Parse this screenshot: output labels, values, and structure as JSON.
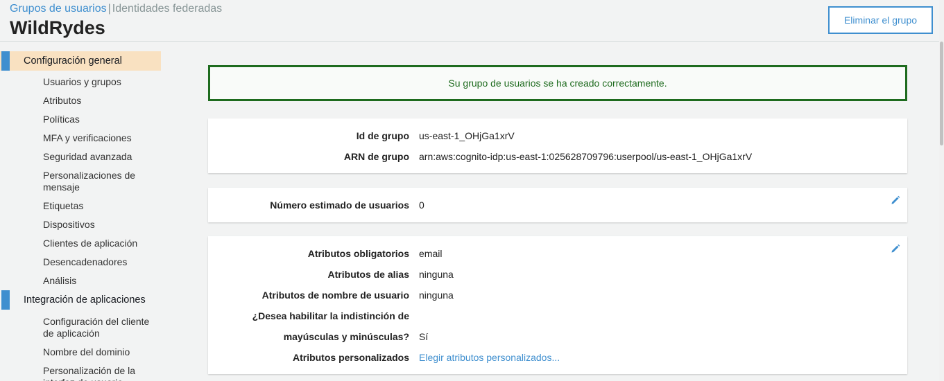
{
  "header": {
    "breadcrumb_link": "Grupos de usuarios",
    "breadcrumb_sep": "|",
    "breadcrumb_other": "Identidades federadas",
    "title": "WildRydes",
    "delete_label": "Eliminar el grupo"
  },
  "sidebar": {
    "general": {
      "label": "Configuración general",
      "items": [
        "Usuarios y grupos",
        "Atributos",
        "Políticas",
        "MFA y verificaciones",
        "Seguridad avanzada",
        "Personalizaciones de mensaje",
        "Etiquetas",
        "Dispositivos",
        "Clientes de aplicación",
        "Desencadenadores",
        "Análisis"
      ]
    },
    "integration": {
      "label": "Integración de aplicaciones",
      "items": [
        "Configuración del cliente de aplicación",
        "Nombre del dominio",
        "Personalización de la interfaz de usuario"
      ]
    }
  },
  "alert": {
    "message": "Su grupo de usuarios se ha creado correctamente."
  },
  "pool_info": {
    "id_label": "Id de grupo",
    "id_value": "us-east-1_OHjGa1xrV",
    "arn_label": "ARN de grupo",
    "arn_value": "arn:aws:cognito-idp:us-east-1:025628709796:userpool/us-east-1_OHjGa1xrV"
  },
  "users": {
    "count_label": "Número estimado de usuarios",
    "count_value": "0"
  },
  "attributes": {
    "required_label": "Atributos obligatorios",
    "required_value": "email",
    "alias_label": "Atributos de alias",
    "alias_value": "ninguna",
    "username_label": "Atributos de nombre de usuario",
    "username_value": "ninguna",
    "case_label_1": "¿Desea habilitar la indistinción de",
    "case_label_2": "mayúsculas y minúsculas?",
    "case_value": "Sí",
    "custom_label": "Atributos personalizados",
    "custom_link": "Elegir atributos personalizados..."
  },
  "colors": {
    "accent": "#3f8fcf",
    "success": "#1e6b1e",
    "active_nav": "#f9e1c1"
  },
  "icons": [
    "pencil-icon"
  ]
}
